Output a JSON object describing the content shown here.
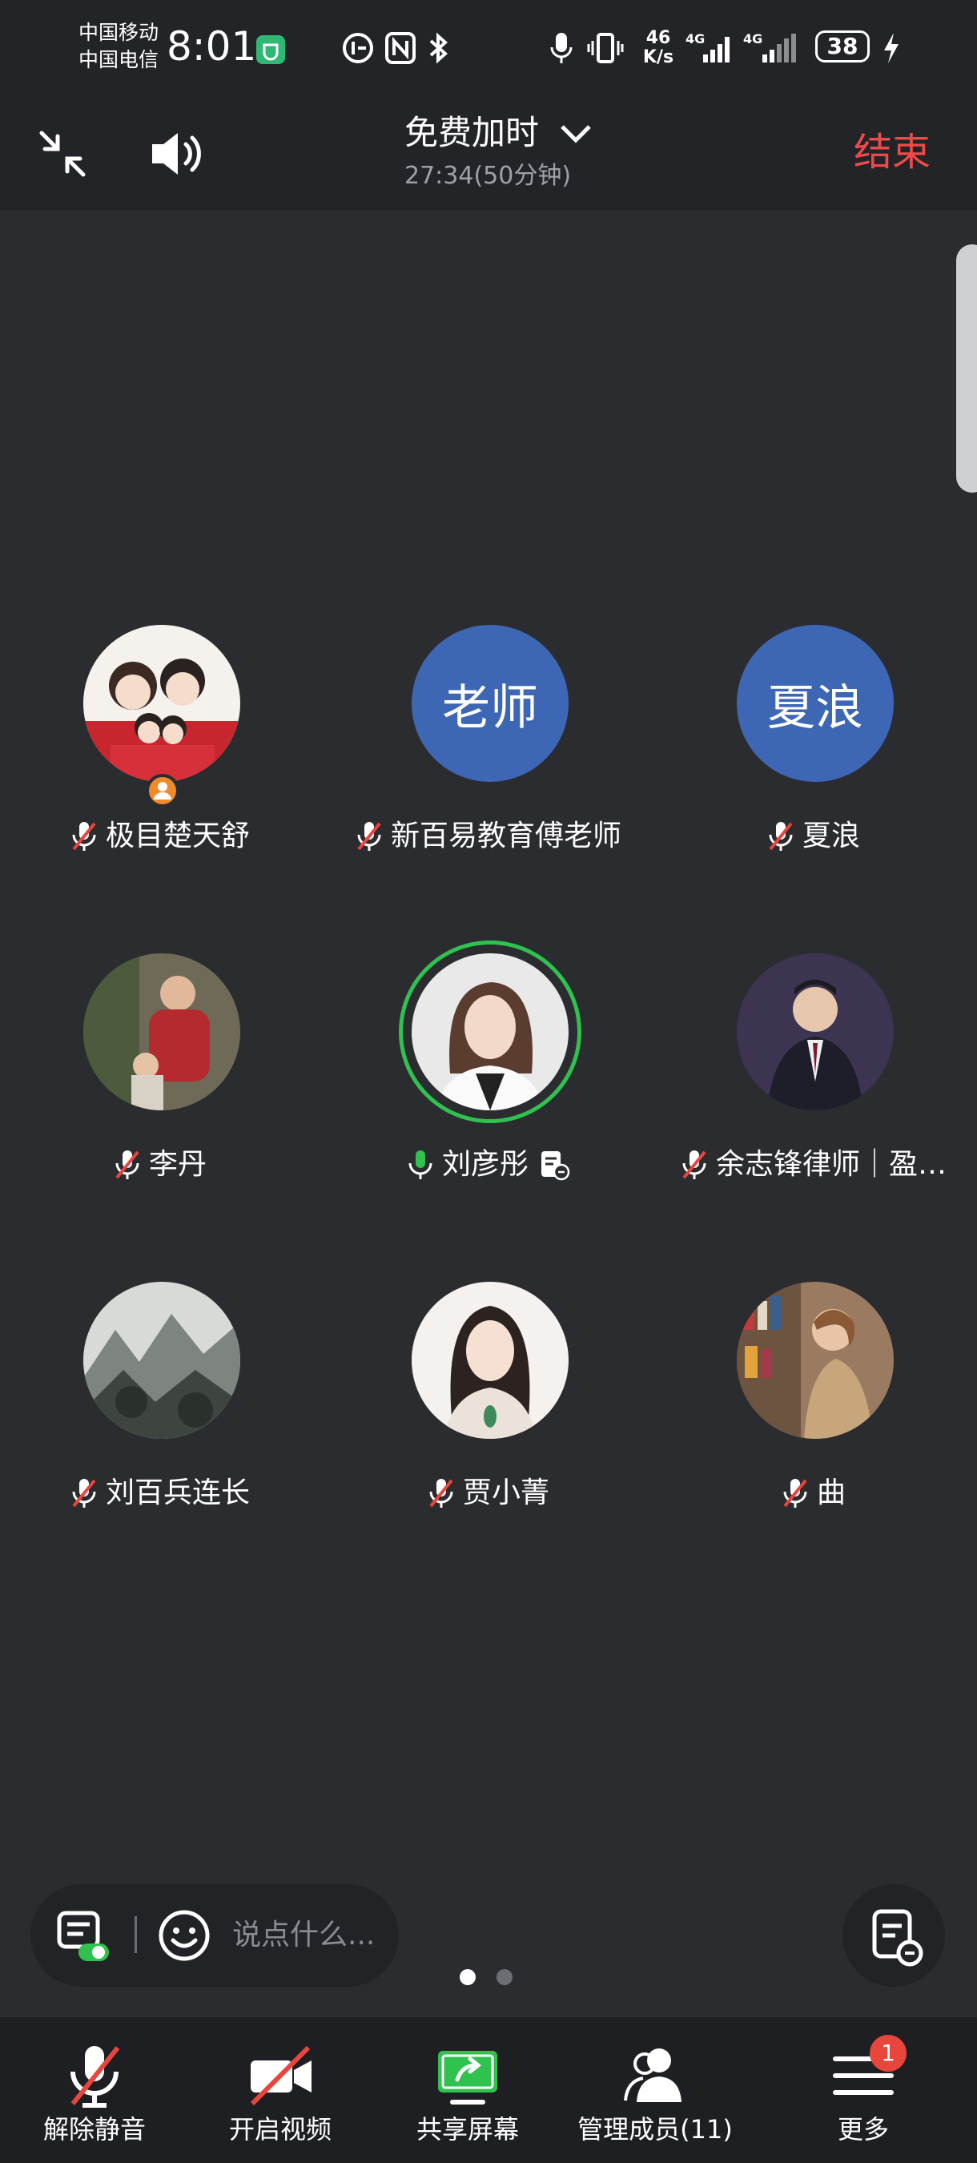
{
  "status_bar": {
    "carrier_1": "中国移动",
    "carrier_2": "中国电信",
    "time": "8:01",
    "net_speed_value": "46",
    "net_speed_unit": "K/s",
    "signal_1": "4G",
    "signal_2": "4G",
    "battery": "38"
  },
  "top_bar": {
    "title": "免费加时",
    "subtitle": "27:34(50分钟)",
    "end_label": "结束"
  },
  "participants": [
    {
      "name": "极目楚天舒",
      "avatar_text": "",
      "muted": true,
      "speaking": false,
      "host": true
    },
    {
      "name": "新百易教育傅老师",
      "avatar_text": "老师",
      "muted": true,
      "speaking": false,
      "host": false
    },
    {
      "name": "夏浪",
      "avatar_text": "夏浪",
      "muted": true,
      "speaking": false,
      "host": false
    },
    {
      "name": "李丹",
      "avatar_text": "",
      "muted": true,
      "speaking": false,
      "host": false
    },
    {
      "name": "刘彦彤",
      "avatar_text": "",
      "muted": false,
      "speaking": true,
      "host": false
    },
    {
      "name": "余志锋律师｜盈…",
      "avatar_text": "",
      "muted": true,
      "speaking": false,
      "host": false
    },
    {
      "name": "刘百兵连长",
      "avatar_text": "",
      "muted": true,
      "speaking": false,
      "host": false
    },
    {
      "name": "贾小菁",
      "avatar_text": "",
      "muted": true,
      "speaking": false,
      "host": false
    },
    {
      "name": "曲",
      "avatar_text": "",
      "muted": true,
      "speaking": false,
      "host": false
    }
  ],
  "chat": {
    "placeholder": "说点什么..."
  },
  "pagination": {
    "current": 1,
    "total": 2
  },
  "toolbar": {
    "items": [
      {
        "label": "解除静音",
        "icon": "mic-muted-icon"
      },
      {
        "label": "开启视频",
        "icon": "video-off-icon"
      },
      {
        "label": "共享屏幕",
        "icon": "share-screen-icon"
      },
      {
        "label": "管理成员(11)",
        "icon": "members-icon"
      },
      {
        "label": "更多",
        "icon": "menu-icon"
      }
    ],
    "more_badge": "1"
  },
  "colors": {
    "background": "#2b2c30",
    "end": "#ef4a4a",
    "speaking": "#2fc24e",
    "avatar_blue": "#3d66b4",
    "share_green": "#2fc24e"
  }
}
